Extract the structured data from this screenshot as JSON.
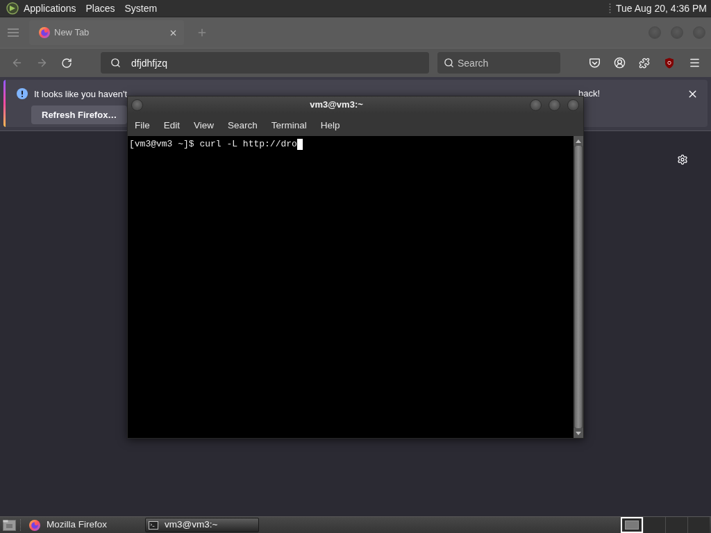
{
  "top_panel": {
    "menus": [
      "Applications",
      "Places",
      "System"
    ],
    "clock": "Tue Aug 20, 4:36 PM"
  },
  "browser": {
    "tabs": [
      {
        "title": "New Tab",
        "selected": true
      }
    ],
    "url_bar": {
      "value": "dfjdhfjzq"
    },
    "search_bar": {
      "placeholder": "Search"
    },
    "notification": {
      "message_start": "It looks like you haven't",
      "message_end": "back!",
      "button": "Refresh Firefox…"
    }
  },
  "terminal": {
    "title": "vm3@vm3:~",
    "menus": [
      "File",
      "Edit",
      "View",
      "Search",
      "Terminal",
      "Help"
    ],
    "lines": [
      "[vm3@vm3 ~]$ curl -L http://dro"
    ]
  },
  "taskbar": {
    "tasks": [
      {
        "title": "Mozilla Firefox",
        "kind": "browser",
        "selected": false
      },
      {
        "title": "vm3@vm3:~",
        "kind": "terminal",
        "selected": true
      }
    ],
    "workspaces": [
      {
        "selected": true,
        "has_windows": true
      },
      {
        "selected": false,
        "has_windows": false
      },
      {
        "selected": false,
        "has_windows": false
      },
      {
        "selected": false,
        "has_windows": false
      }
    ]
  }
}
